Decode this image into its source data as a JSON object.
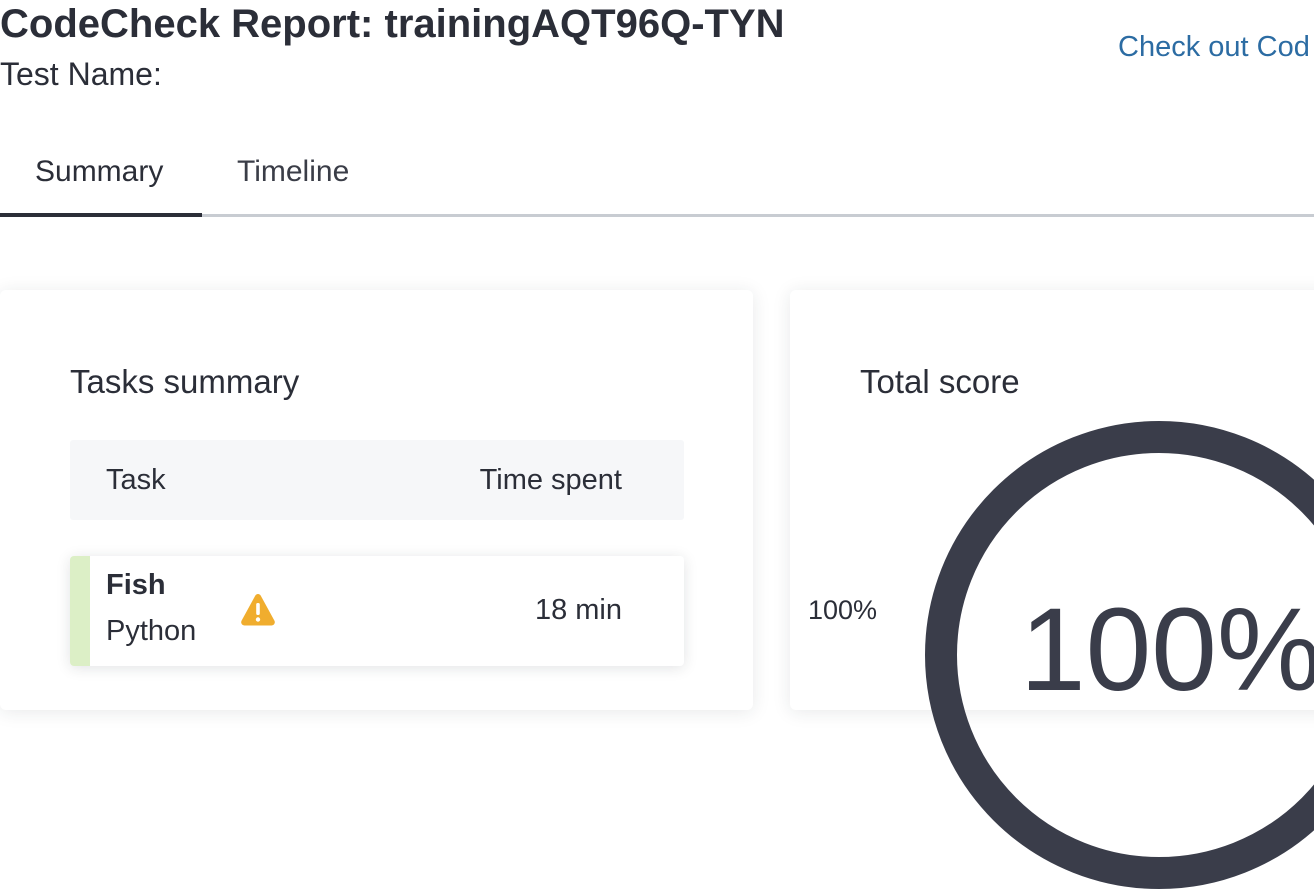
{
  "header": {
    "title": "CodeCheck Report: trainingAQT96Q-TYN",
    "test_name_label": "Test Name:",
    "promo_link": "Check out Cod"
  },
  "tabs": [
    {
      "label": "Summary",
      "active": true
    },
    {
      "label": "Timeline",
      "active": false
    }
  ],
  "tasks_summary": {
    "title": "Tasks summary",
    "columns": [
      "Task",
      "Time spent"
    ],
    "rows": [
      {
        "name": "Fish",
        "language": "Python",
        "time_spent": "18 min",
        "warning_icon": "warning-triangle-icon"
      }
    ]
  },
  "total_score": {
    "title": "Total score",
    "side_label": "100%",
    "value": "100%",
    "fraction": 1.0
  },
  "colors": {
    "accent_link": "#2c6ca3",
    "task_status": "#dcefc6",
    "warning": "#f0ad2e",
    "gauge": "#3a3d4a"
  }
}
